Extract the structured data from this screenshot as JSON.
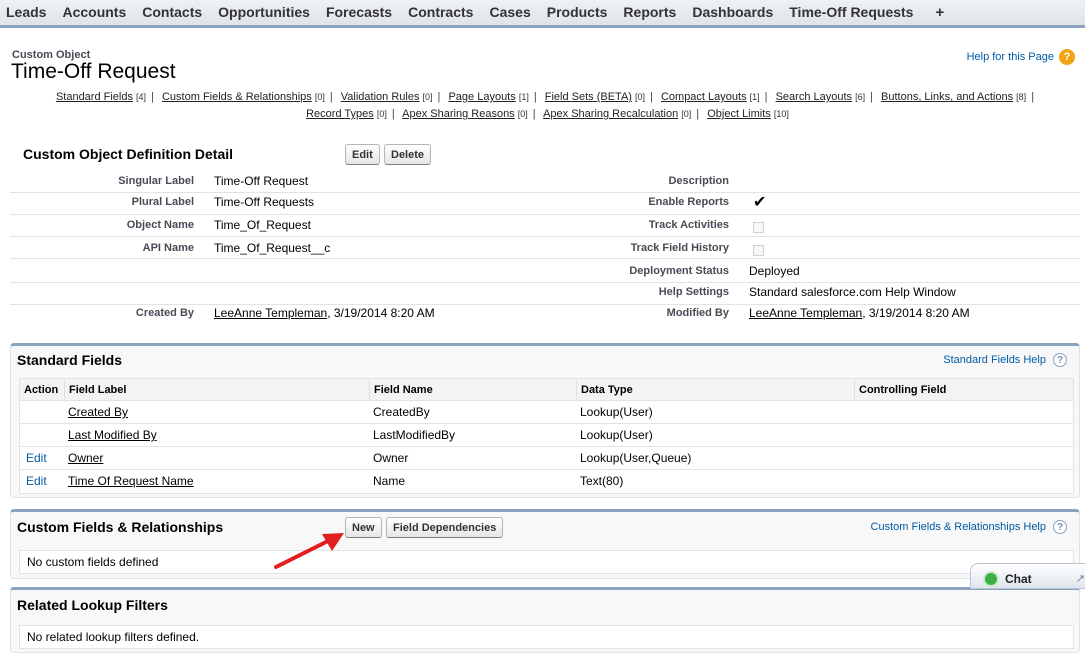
{
  "tabs": [
    "Leads",
    "Accounts",
    "Contacts",
    "Opportunities",
    "Forecasts",
    "Contracts",
    "Cases",
    "Products",
    "Reports",
    "Dashboards",
    "Time-Off Requests",
    "+"
  ],
  "header": {
    "object_type": "Custom Object",
    "title": "Time-Off Request",
    "help_link": "Help for this Page",
    "help_icon": "?"
  },
  "quick_links": {
    "row1": [
      {
        "label": "Standard Fields",
        "count": "[4]"
      },
      {
        "label": "Custom Fields & Relationships",
        "count": "[0]"
      },
      {
        "label": "Validation Rules",
        "count": "[0]"
      },
      {
        "label": "Page Layouts",
        "count": "[1]"
      },
      {
        "label": "Field Sets (BETA)",
        "count": "[0]"
      },
      {
        "label": "Compact Layouts",
        "count": "[1]"
      },
      {
        "label": "Search Layouts",
        "count": "[6]"
      },
      {
        "label": "Buttons, Links, and Actions",
        "count": "[8]"
      }
    ],
    "row2": [
      {
        "label": "Record Types",
        "count": "[0]"
      },
      {
        "label": "Apex Sharing Reasons",
        "count": "[0]"
      },
      {
        "label": "Apex Sharing Recalculation",
        "count": "[0]"
      },
      {
        "label": "Object Limits",
        "count": "[10]"
      }
    ]
  },
  "detail": {
    "title": "Custom Object Definition Detail",
    "edit_label": "Edit",
    "delete_label": "Delete",
    "singular_label": {
      "label": "Singular Label",
      "value": "Time-Off Request"
    },
    "plural_label": {
      "label": "Plural Label",
      "value": "Time-Off Requests"
    },
    "object_name": {
      "label": "Object Name",
      "value": "Time_Of_Request"
    },
    "api_name": {
      "label": "API Name",
      "value": "Time_Of_Request__c"
    },
    "created_by": {
      "label": "Created By",
      "user": "LeeAnne Templeman",
      "date": ", 3/19/2014 8:20 AM"
    },
    "description": {
      "label": "Description",
      "value": ""
    },
    "enable_reports": {
      "label": "Enable Reports",
      "value": "✔"
    },
    "track_activities": {
      "label": "Track Activities"
    },
    "track_field_history": {
      "label": "Track Field History"
    },
    "deployment_status": {
      "label": "Deployment Status",
      "value": "Deployed"
    },
    "help_settings": {
      "label": "Help Settings",
      "value": "Standard salesforce.com Help Window"
    },
    "modified_by": {
      "label": "Modified By",
      "user": "LeeAnne Templeman",
      "date": ", 3/19/2014 8:20 AM"
    }
  },
  "standard_fields": {
    "title": "Standard Fields",
    "help_link": "Standard Fields Help",
    "columns": [
      "Action",
      "Field Label",
      "Field Name",
      "Data Type",
      "Controlling Field"
    ],
    "rows": [
      {
        "action": "",
        "label": "Created By",
        "name": "CreatedBy",
        "type": "Lookup(User)",
        "controlling": ""
      },
      {
        "action": "",
        "label": "Last Modified By",
        "name": "LastModifiedBy",
        "type": "Lookup(User)",
        "controlling": ""
      },
      {
        "action": "Edit",
        "label": "Owner",
        "name": "Owner",
        "type": "Lookup(User,Queue)",
        "controlling": ""
      },
      {
        "action": "Edit",
        "label": "Time Of Request Name",
        "name": "Name",
        "type": "Text(80)",
        "controlling": ""
      }
    ]
  },
  "custom_fields": {
    "title": "Custom Fields & Relationships",
    "new_label": "New",
    "field_dependencies_label": "Field Dependencies",
    "help_link": "Custom Fields & Relationships Help",
    "empty_message": "No custom fields defined"
  },
  "lookup_filters": {
    "title": "Related Lookup Filters",
    "empty_message": "No related lookup filters defined."
  },
  "chat": {
    "label": "Chat"
  },
  "colors": {
    "link": "#015ba7",
    "tab_border": "#8aa4bf",
    "arrow": "#e02020"
  }
}
